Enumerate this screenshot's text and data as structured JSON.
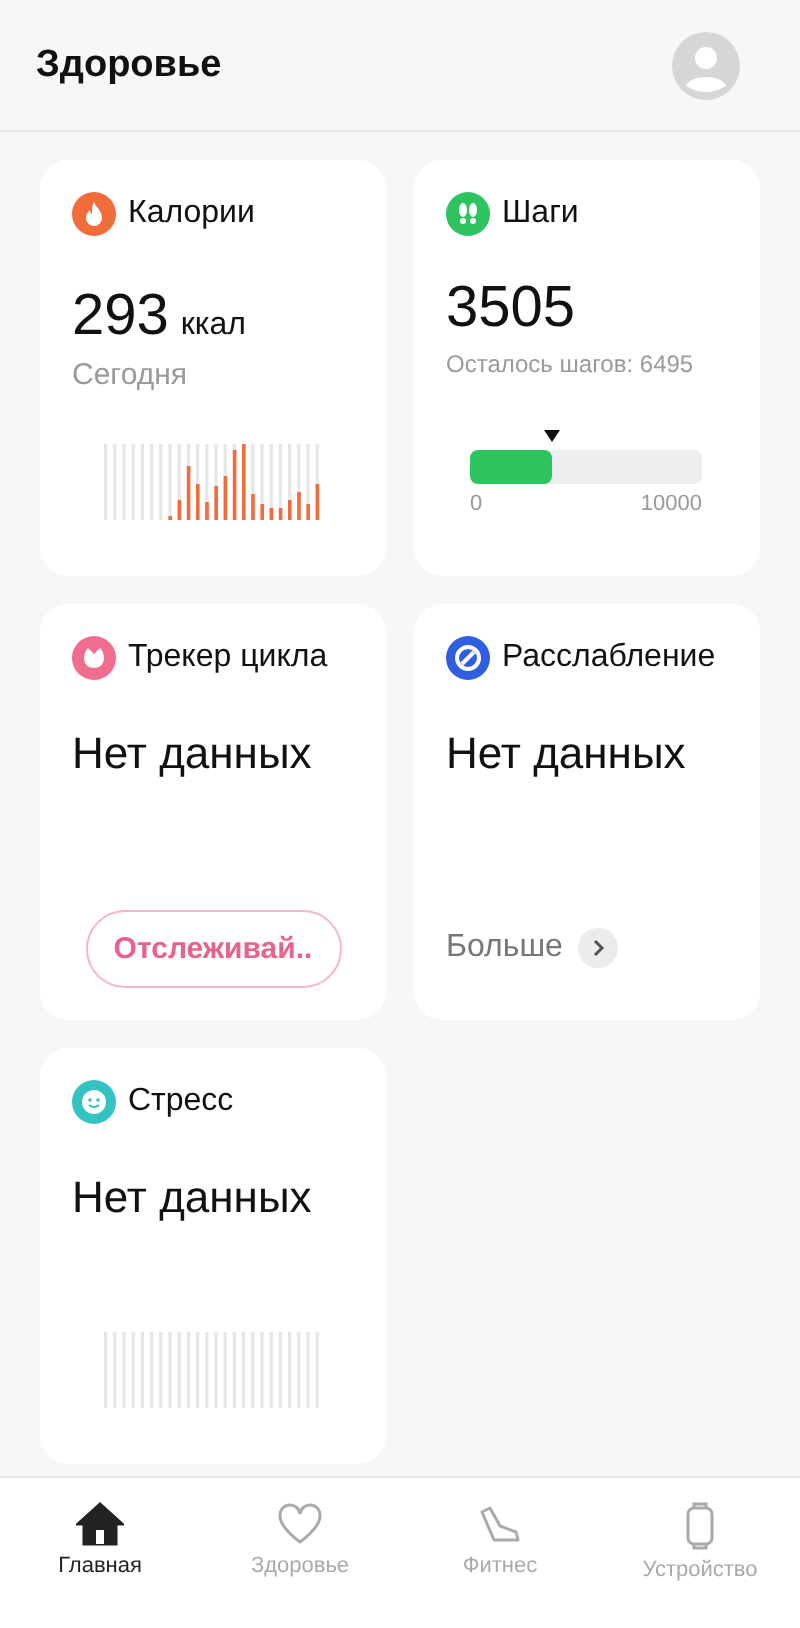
{
  "header": {
    "title": "Здоровье"
  },
  "cards": [
    {
      "kind": "calories",
      "title": "Калории",
      "color": "#f26b3a",
      "value": "293",
      "unit": "ккал",
      "caption": "Сегодня"
    },
    {
      "kind": "steps",
      "title": "Шаги",
      "color": "#2dc45f",
      "value": "3505",
      "caption": "Осталось шагов: 6495",
      "level": 0.3505,
      "scale_min": "0",
      "scale_max": "10000"
    },
    {
      "kind": "cycle",
      "title": "Трекер цикла",
      "color": "#f06d8f",
      "value": "Нет данных",
      "button": "Отслеживай.."
    },
    {
      "kind": "relax",
      "title": "Расслабление",
      "color": "#2f5fe0",
      "value": "Нет данных",
      "link": "Больше"
    },
    {
      "kind": "stress",
      "title": "Стресс",
      "color": "#35c2c2",
      "value": "Нет данных"
    }
  ],
  "nav": [
    {
      "kind": "home",
      "label": "Главная",
      "selected": true
    },
    {
      "kind": "health",
      "label": "Здоровье",
      "selected": false
    },
    {
      "kind": "fitness",
      "label": "Фитнес",
      "selected": false
    },
    {
      "kind": "device",
      "label": "Устройство",
      "selected": false
    }
  ]
}
